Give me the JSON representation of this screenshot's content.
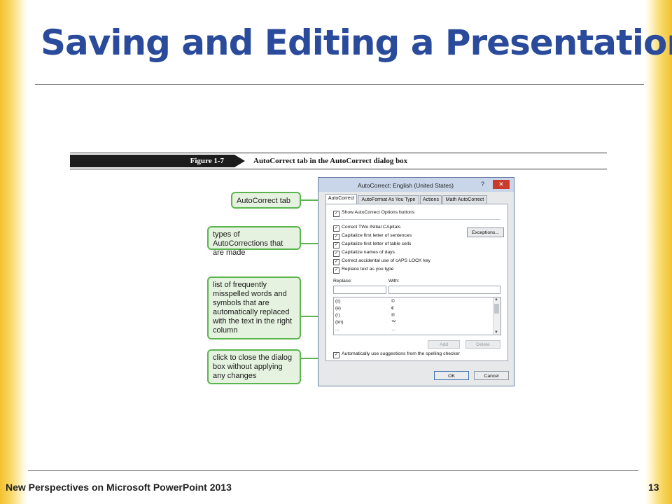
{
  "slide": {
    "title": "Saving and Editing a Presentation",
    "footer": "New Perspectives on Microsoft PowerPoint 2013",
    "page_number": "13"
  },
  "figure": {
    "label": "Figure 1-7",
    "caption": "AutoCorrect tab in the AutoCorrect dialog box"
  },
  "callouts": [
    "AutoCorrect tab",
    "types of AutoCorrections that are made",
    "list of frequently misspelled words and symbols that are automatically replaced with the text in the right column",
    "click to close the dialog box without applying any changes"
  ],
  "dialog": {
    "title": "AutoCorrect: English (United States)",
    "help": "?",
    "close": "✕",
    "tabs": [
      "AutoCorrect",
      "AutoFormat As You Type",
      "Actions",
      "Math AutoCorrect"
    ],
    "show_options": "Show AutoCorrect Options buttons",
    "options": [
      "Correct TWo INitial CApitals",
      "Capitalize first letter of sentences",
      "Capitalize first letter of table cells",
      "Capitalize names of days",
      "Correct accidental use of cAPS LOCK key",
      "Replace text as you type"
    ],
    "exceptions_button": "Exceptions...",
    "replace_label": "Replace:",
    "with_label": "With:",
    "list": [
      {
        "replace": "(c)",
        "with": "©"
      },
      {
        "replace": "(e)",
        "with": "€"
      },
      {
        "replace": "(r)",
        "with": "®"
      },
      {
        "replace": "(tm)",
        "with": "™"
      },
      {
        "replace": "...",
        "with": "…"
      }
    ],
    "add_button": "Add",
    "delete_button": "Delete",
    "spelling_option": "Automatically use suggestions from the spelling checker",
    "ok_button": "OK",
    "cancel_button": "Cancel"
  },
  "colors": {
    "title": "#2a4b9b",
    "callout_fill": "#e5f2df",
    "callout_border": "#5bb54e",
    "close_button": "#c93c2c",
    "edge": "#f2c12e"
  }
}
